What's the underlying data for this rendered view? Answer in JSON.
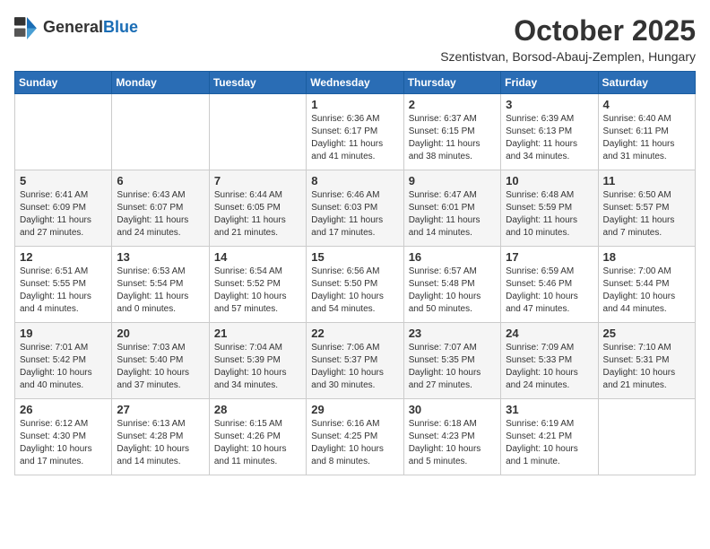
{
  "logo": {
    "general": "General",
    "blue": "Blue"
  },
  "title": "October 2025",
  "location": "Szentistvan, Borsod-Abauj-Zemplen, Hungary",
  "days_of_week": [
    "Sunday",
    "Monday",
    "Tuesday",
    "Wednesday",
    "Thursday",
    "Friday",
    "Saturday"
  ],
  "weeks": [
    [
      {
        "day": "",
        "info": ""
      },
      {
        "day": "",
        "info": ""
      },
      {
        "day": "",
        "info": ""
      },
      {
        "day": "1",
        "info": "Sunrise: 6:36 AM\nSunset: 6:17 PM\nDaylight: 11 hours\nand 41 minutes."
      },
      {
        "day": "2",
        "info": "Sunrise: 6:37 AM\nSunset: 6:15 PM\nDaylight: 11 hours\nand 38 minutes."
      },
      {
        "day": "3",
        "info": "Sunrise: 6:39 AM\nSunset: 6:13 PM\nDaylight: 11 hours\nand 34 minutes."
      },
      {
        "day": "4",
        "info": "Sunrise: 6:40 AM\nSunset: 6:11 PM\nDaylight: 11 hours\nand 31 minutes."
      }
    ],
    [
      {
        "day": "5",
        "info": "Sunrise: 6:41 AM\nSunset: 6:09 PM\nDaylight: 11 hours\nand 27 minutes."
      },
      {
        "day": "6",
        "info": "Sunrise: 6:43 AM\nSunset: 6:07 PM\nDaylight: 11 hours\nand 24 minutes."
      },
      {
        "day": "7",
        "info": "Sunrise: 6:44 AM\nSunset: 6:05 PM\nDaylight: 11 hours\nand 21 minutes."
      },
      {
        "day": "8",
        "info": "Sunrise: 6:46 AM\nSunset: 6:03 PM\nDaylight: 11 hours\nand 17 minutes."
      },
      {
        "day": "9",
        "info": "Sunrise: 6:47 AM\nSunset: 6:01 PM\nDaylight: 11 hours\nand 14 minutes."
      },
      {
        "day": "10",
        "info": "Sunrise: 6:48 AM\nSunset: 5:59 PM\nDaylight: 11 hours\nand 10 minutes."
      },
      {
        "day": "11",
        "info": "Sunrise: 6:50 AM\nSunset: 5:57 PM\nDaylight: 11 hours\nand 7 minutes."
      }
    ],
    [
      {
        "day": "12",
        "info": "Sunrise: 6:51 AM\nSunset: 5:55 PM\nDaylight: 11 hours\nand 4 minutes."
      },
      {
        "day": "13",
        "info": "Sunrise: 6:53 AM\nSunset: 5:54 PM\nDaylight: 11 hours\nand 0 minutes."
      },
      {
        "day": "14",
        "info": "Sunrise: 6:54 AM\nSunset: 5:52 PM\nDaylight: 10 hours\nand 57 minutes."
      },
      {
        "day": "15",
        "info": "Sunrise: 6:56 AM\nSunset: 5:50 PM\nDaylight: 10 hours\nand 54 minutes."
      },
      {
        "day": "16",
        "info": "Sunrise: 6:57 AM\nSunset: 5:48 PM\nDaylight: 10 hours\nand 50 minutes."
      },
      {
        "day": "17",
        "info": "Sunrise: 6:59 AM\nSunset: 5:46 PM\nDaylight: 10 hours\nand 47 minutes."
      },
      {
        "day": "18",
        "info": "Sunrise: 7:00 AM\nSunset: 5:44 PM\nDaylight: 10 hours\nand 44 minutes."
      }
    ],
    [
      {
        "day": "19",
        "info": "Sunrise: 7:01 AM\nSunset: 5:42 PM\nDaylight: 10 hours\nand 40 minutes."
      },
      {
        "day": "20",
        "info": "Sunrise: 7:03 AM\nSunset: 5:40 PM\nDaylight: 10 hours\nand 37 minutes."
      },
      {
        "day": "21",
        "info": "Sunrise: 7:04 AM\nSunset: 5:39 PM\nDaylight: 10 hours\nand 34 minutes."
      },
      {
        "day": "22",
        "info": "Sunrise: 7:06 AM\nSunset: 5:37 PM\nDaylight: 10 hours\nand 30 minutes."
      },
      {
        "day": "23",
        "info": "Sunrise: 7:07 AM\nSunset: 5:35 PM\nDaylight: 10 hours\nand 27 minutes."
      },
      {
        "day": "24",
        "info": "Sunrise: 7:09 AM\nSunset: 5:33 PM\nDaylight: 10 hours\nand 24 minutes."
      },
      {
        "day": "25",
        "info": "Sunrise: 7:10 AM\nSunset: 5:31 PM\nDaylight: 10 hours\nand 21 minutes."
      }
    ],
    [
      {
        "day": "26",
        "info": "Sunrise: 6:12 AM\nSunset: 4:30 PM\nDaylight: 10 hours\nand 17 minutes."
      },
      {
        "day": "27",
        "info": "Sunrise: 6:13 AM\nSunset: 4:28 PM\nDaylight: 10 hours\nand 14 minutes."
      },
      {
        "day": "28",
        "info": "Sunrise: 6:15 AM\nSunset: 4:26 PM\nDaylight: 10 hours\nand 11 minutes."
      },
      {
        "day": "29",
        "info": "Sunrise: 6:16 AM\nSunset: 4:25 PM\nDaylight: 10 hours\nand 8 minutes."
      },
      {
        "day": "30",
        "info": "Sunrise: 6:18 AM\nSunset: 4:23 PM\nDaylight: 10 hours\nand 5 minutes."
      },
      {
        "day": "31",
        "info": "Sunrise: 6:19 AM\nSunset: 4:21 PM\nDaylight: 10 hours\nand 1 minute."
      },
      {
        "day": "",
        "info": ""
      }
    ]
  ]
}
